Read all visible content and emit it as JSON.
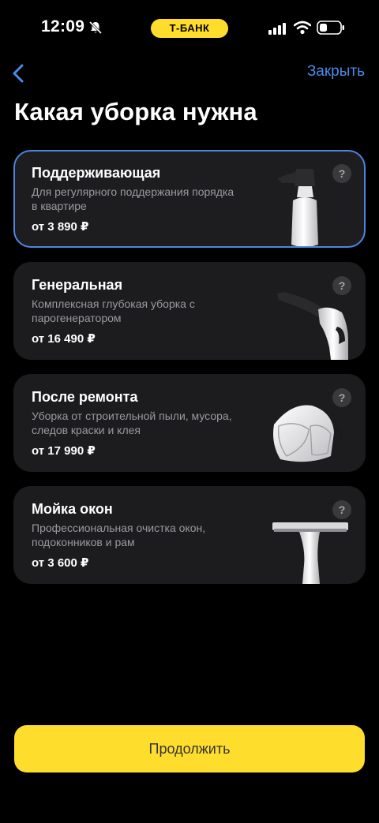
{
  "status_bar": {
    "time": "12:09",
    "bank_label": "Т-БАНК",
    "icons": [
      "bell-muted-icon",
      "signal-icon",
      "wifi-icon",
      "battery-icon"
    ]
  },
  "nav": {
    "back_icon": "chevron-left-icon",
    "close_label": "Закрыть"
  },
  "title": "Какая уборка нужна",
  "options": [
    {
      "title": "Поддерживающая",
      "description": "Для регулярного поддержания порядка в квартире",
      "price": "от 3 890 ₽",
      "help": "?",
      "image": "spray-bottle",
      "selected": true
    },
    {
      "title": "Генеральная",
      "description": "Комплексная глубокая уборка с парогенератором",
      "price": "от 16 490 ₽",
      "help": "?",
      "image": "steamer",
      "selected": false
    },
    {
      "title": "После ремонта",
      "description": "Уборка от строительной пыли, мусора, следов краски и клея",
      "price": "от 17 990 ₽",
      "help": "?",
      "image": "respirator-mask",
      "selected": false
    },
    {
      "title": "Мойка окон",
      "description": "Профессиональная очистка окон, подоконников и рам",
      "price": "от 3 600 ₽",
      "help": "?",
      "image": "window-squeegee",
      "selected": false
    }
  ],
  "continue_label": "Продолжить",
  "colors": {
    "background": "#000000",
    "card": "#1c1c1e",
    "accent_yellow": "#ffdd2d",
    "selected_border": "#4a86e0",
    "link_blue": "#4a8ce8",
    "secondary_text": "#9a9aa0"
  }
}
